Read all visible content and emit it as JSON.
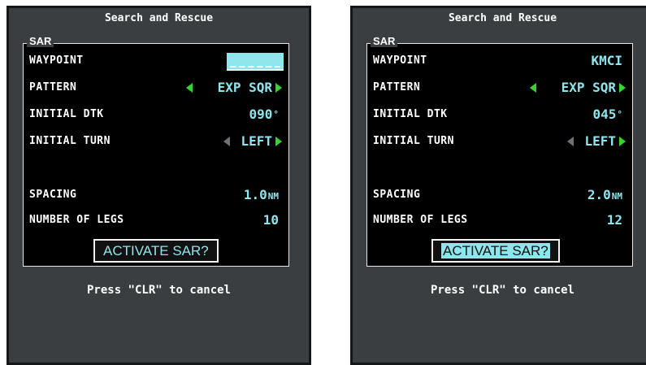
{
  "left": {
    "title": "Search and Rescue",
    "group_label": "SAR",
    "fields": [
      {
        "label": "WAYPOINT",
        "value": "______"
      },
      {
        "label": "PATTERN",
        "value": "EXP SQR"
      },
      {
        "label": "INITIAL DTK",
        "value": "090",
        "suffix": "°"
      },
      {
        "label": "INITIAL TURN",
        "value": "LEFT"
      },
      {
        "label": "SPACING",
        "value": "1.0",
        "suffix": "NM"
      },
      {
        "label": "NUMBER OF LEGS",
        "value": "10"
      }
    ],
    "activate_label": "ACTIVATE SAR?",
    "hint": "Press \"CLR\" to cancel"
  },
  "right": {
    "title": "Search and Rescue",
    "group_label": "SAR",
    "fields": [
      {
        "label": "WAYPOINT",
        "value": "KMCI"
      },
      {
        "label": "PATTERN",
        "value": "EXP SQR"
      },
      {
        "label": "INITIAL DTK",
        "value": "045",
        "suffix": "°"
      },
      {
        "label": "INITIAL TURN",
        "value": "LEFT"
      },
      {
        "label": "SPACING",
        "value": "2.0",
        "suffix": "NM"
      },
      {
        "label": "NUMBER OF LEGS",
        "value": "12"
      }
    ],
    "activate_label": "ACTIVATE SAR?",
    "hint": "Press \"CLR\" to cancel"
  },
  "colors": {
    "value_cyan": "#8ee5ec",
    "arrow_green": "#36d42f",
    "panel_gray": "#3b3e40"
  }
}
